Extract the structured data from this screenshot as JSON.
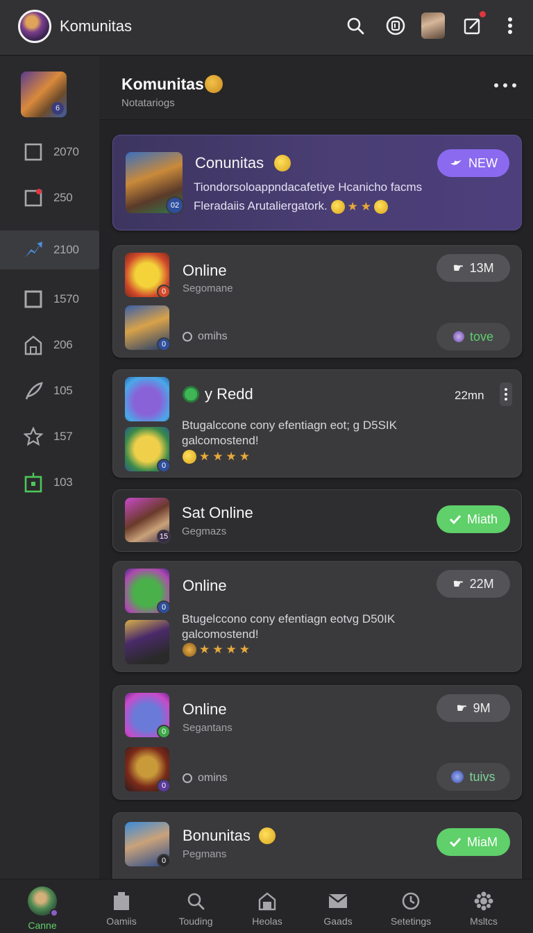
{
  "topbar": {
    "title": "Komunitas",
    "icons": [
      "search-icon",
      "discord-icon",
      "user-avatar",
      "compose-icon",
      "more-vert-icon"
    ]
  },
  "sidebar": {
    "items": [
      {
        "icon": "square-icon",
        "count": "2070"
      },
      {
        "icon": "notification-square-icon",
        "count": "250"
      },
      {
        "icon": "share-arrow-icon",
        "count": "2100",
        "active": true
      },
      {
        "icon": "square-outline-icon",
        "count": "1570"
      },
      {
        "icon": "house-icon",
        "count": "206"
      },
      {
        "icon": "feather-icon",
        "count": "105"
      },
      {
        "icon": "star-icon",
        "count": "157"
      },
      {
        "icon": "green-box-icon",
        "count": "103"
      }
    ]
  },
  "header": {
    "title": "Komunitas",
    "subtitle": "Notatariogs"
  },
  "cards": [
    {
      "title": "Conunitas",
      "text_line1": "Tiondorsoloappndacafetiye Hcanicho facms",
      "text_line2": "Fleradaiis Arutaliergatork.",
      "badge": "NEW",
      "thumb_badge": "02"
    },
    {
      "title": "Online",
      "subtitle": "Segomane",
      "meta": "omihs",
      "count": "13M",
      "action": "tove",
      "thumb_badges": [
        "0",
        "0"
      ]
    },
    {
      "title": "y Redd",
      "time": "22mn",
      "body_line1": "Btugalccone cony efentiagn eot; g D5SIK",
      "body_line2": "galcomostend!",
      "thumb_badges": [
        "0"
      ]
    },
    {
      "title": "Sat Online",
      "subtitle": "Gegmazs",
      "action": "Miath",
      "thumb_badge": "15"
    },
    {
      "title": "Online",
      "count": "22M",
      "body_line1": "Btugelccono cony efentiagn eotvg D50IK",
      "body_line2": "galcomostend!",
      "thumb_badges": [
        "0"
      ]
    },
    {
      "title": "Online",
      "subtitle": "Segantans",
      "meta": "omins",
      "count": "9M",
      "action": "tuivs",
      "thumb_badges": [
        "0",
        "0"
      ]
    },
    {
      "title": "Bonunitas",
      "subtitle": "Pegmans",
      "action": "MiaM",
      "thumb_badge": "0"
    }
  ],
  "bottomnav": {
    "items": [
      {
        "label": "Canne",
        "active": true
      },
      {
        "label": "Oamiis"
      },
      {
        "label": "Touding"
      },
      {
        "label": "Heolas"
      },
      {
        "label": "Gaads"
      },
      {
        "label": "Setetings"
      },
      {
        "label": "Msltcs"
      }
    ]
  },
  "colors": {
    "accent_green": "#5fd06a",
    "accent_purple": "#8b6af0",
    "background": "#232325"
  }
}
